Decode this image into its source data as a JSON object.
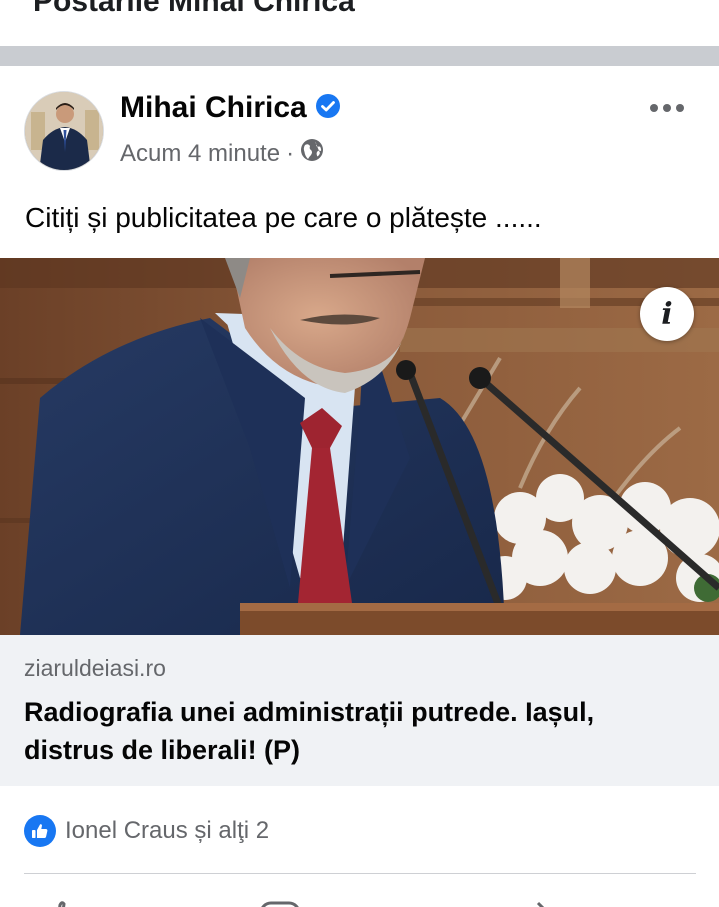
{
  "page_header": {
    "title": "Postările Mihai Chirica"
  },
  "post": {
    "author": "Mihai Chirica",
    "verified_icon": "verified-check-icon",
    "timestamp": "Acum 4 minute",
    "separator_dot": "·",
    "privacy_icon": "globe-icon",
    "more_icon": "more-options-icon",
    "text": "Citiți și publicitatea pe care o plătește ......",
    "link_preview": {
      "info_icon": "info-icon",
      "info_label": "i",
      "domain": "ziaruldeiasi.ro",
      "title": "Radiografia unei administrații putrede. Iașul, distrus de liberali! (P)"
    },
    "reactions": {
      "icon": "like-reaction-icon",
      "text": "Ionel Craus și alţi 2"
    },
    "actions": [
      {
        "name": "like",
        "icon": "like-icon"
      },
      {
        "name": "comment",
        "icon": "comment-icon"
      },
      {
        "name": "share",
        "icon": "share-icon"
      }
    ]
  },
  "colors": {
    "facebook_blue": "#1877f2",
    "secondary_text": "#65676b",
    "separator": "#c9ccd1",
    "link_box_bg": "#f0f2f5"
  }
}
